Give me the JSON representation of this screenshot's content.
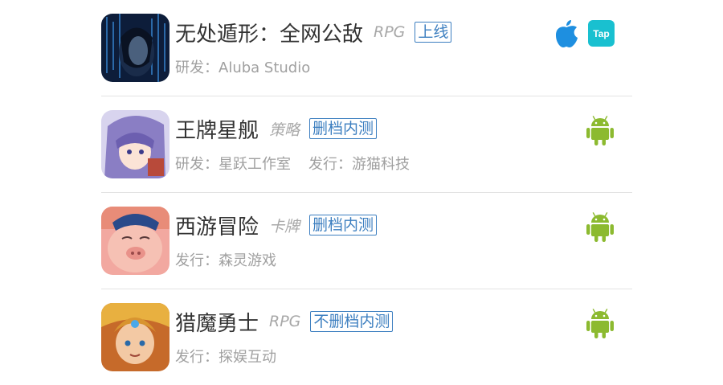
{
  "games": [
    {
      "name": "无处遁形：全网公敌",
      "genre": "RPG",
      "status": "上线",
      "meta": [
        "研发：Aluba Studio"
      ],
      "platforms": [
        "apple-icon",
        "taptap-icon"
      ],
      "taptap_label": "Tap"
    },
    {
      "name": "王牌星舰",
      "genre": "策略",
      "status": "删档内测",
      "meta": [
        "研发：星跃工作室",
        "发行：游猫科技"
      ],
      "platforms": [
        "android-icon"
      ]
    },
    {
      "name": "西游冒险",
      "genre": "卡牌",
      "status": "删档内测",
      "meta": [
        "发行：森灵游戏"
      ],
      "platforms": [
        "android-icon"
      ]
    },
    {
      "name": "猎魔勇士",
      "genre": "RPG",
      "status": "不删档内测",
      "meta": [
        "发行：探娱互动"
      ],
      "platforms": [
        "android-icon"
      ]
    }
  ],
  "colors": {
    "status_blue": "#3d7fc0",
    "apple_blue": "#1e8fe0",
    "taptap_teal": "#19c0d0",
    "android_green": "#8cba30"
  }
}
